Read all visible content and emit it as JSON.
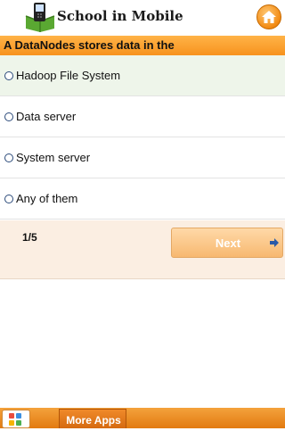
{
  "header": {
    "title": "School in Mobile",
    "logo_icon": "book-mobile-logo-icon",
    "home_icon": "home-icon"
  },
  "question": {
    "text": "A DataNodes stores data in the"
  },
  "options": [
    {
      "label": "Hadoop File System",
      "selected": true
    },
    {
      "label": "Data server",
      "selected": false
    },
    {
      "label": "System server",
      "selected": false
    },
    {
      "label": "Any of them",
      "selected": false
    }
  ],
  "progress": {
    "counter": "1/5"
  },
  "next_button": {
    "label": "Next",
    "icon": "arrow-right-icon"
  },
  "bottom_bar": {
    "apps_icon": "apps-grid-icon",
    "more_apps_label": "More Apps"
  },
  "colors": {
    "accent": "#f7931e",
    "selected_option_bg": "#eef5ea",
    "footer_bg": "#fbeee2"
  }
}
